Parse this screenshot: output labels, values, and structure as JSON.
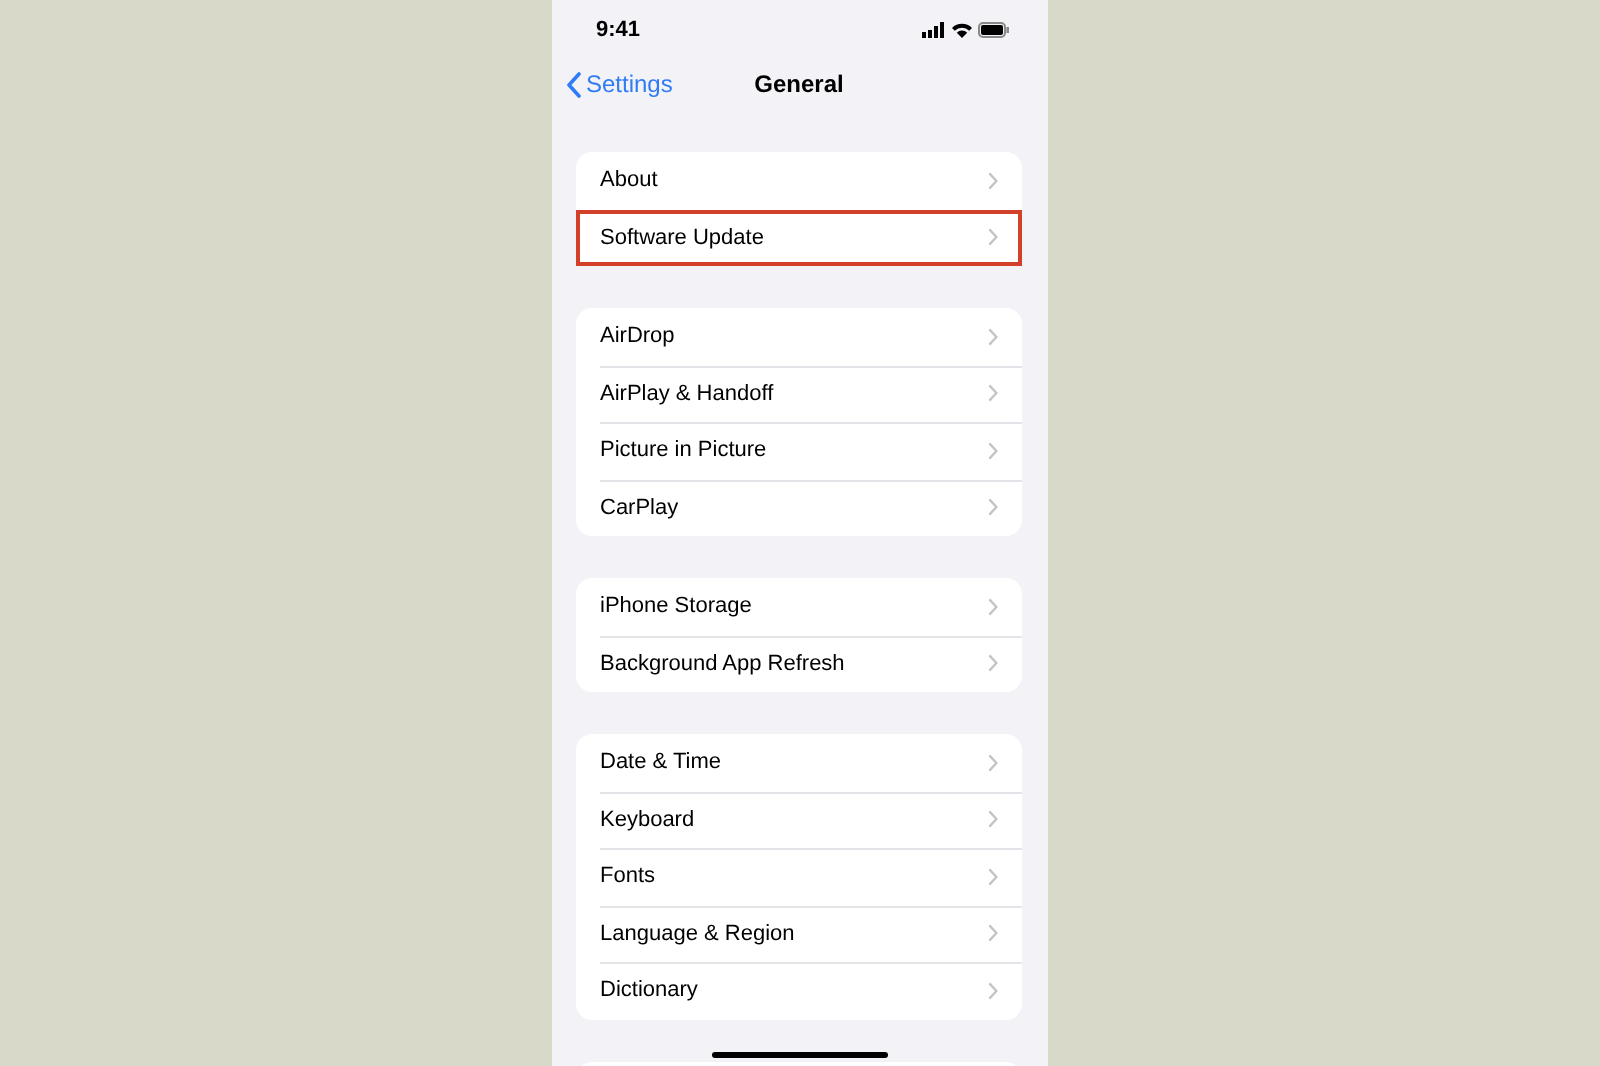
{
  "status_bar": {
    "time": "9:41"
  },
  "nav": {
    "back": "Settings",
    "title": "General"
  },
  "groups": [
    {
      "rows": [
        {
          "label": "About",
          "highlighted": false
        },
        {
          "label": "Software Update",
          "highlighted": true
        }
      ]
    },
    {
      "rows": [
        {
          "label": "AirDrop",
          "highlighted": false
        },
        {
          "label": "AirPlay & Handoff",
          "highlighted": false
        },
        {
          "label": "Picture in Picture",
          "highlighted": false
        },
        {
          "label": "CarPlay",
          "highlighted": false
        }
      ]
    },
    {
      "rows": [
        {
          "label": "iPhone Storage",
          "highlighted": false
        },
        {
          "label": "Background App Refresh",
          "highlighted": false
        }
      ]
    },
    {
      "rows": [
        {
          "label": "Date & Time",
          "highlighted": false
        },
        {
          "label": "Keyboard",
          "highlighted": false
        },
        {
          "label": "Fonts",
          "highlighted": false
        },
        {
          "label": "Language & Region",
          "highlighted": false
        },
        {
          "label": "Dictionary",
          "highlighted": false
        }
      ]
    }
  ]
}
